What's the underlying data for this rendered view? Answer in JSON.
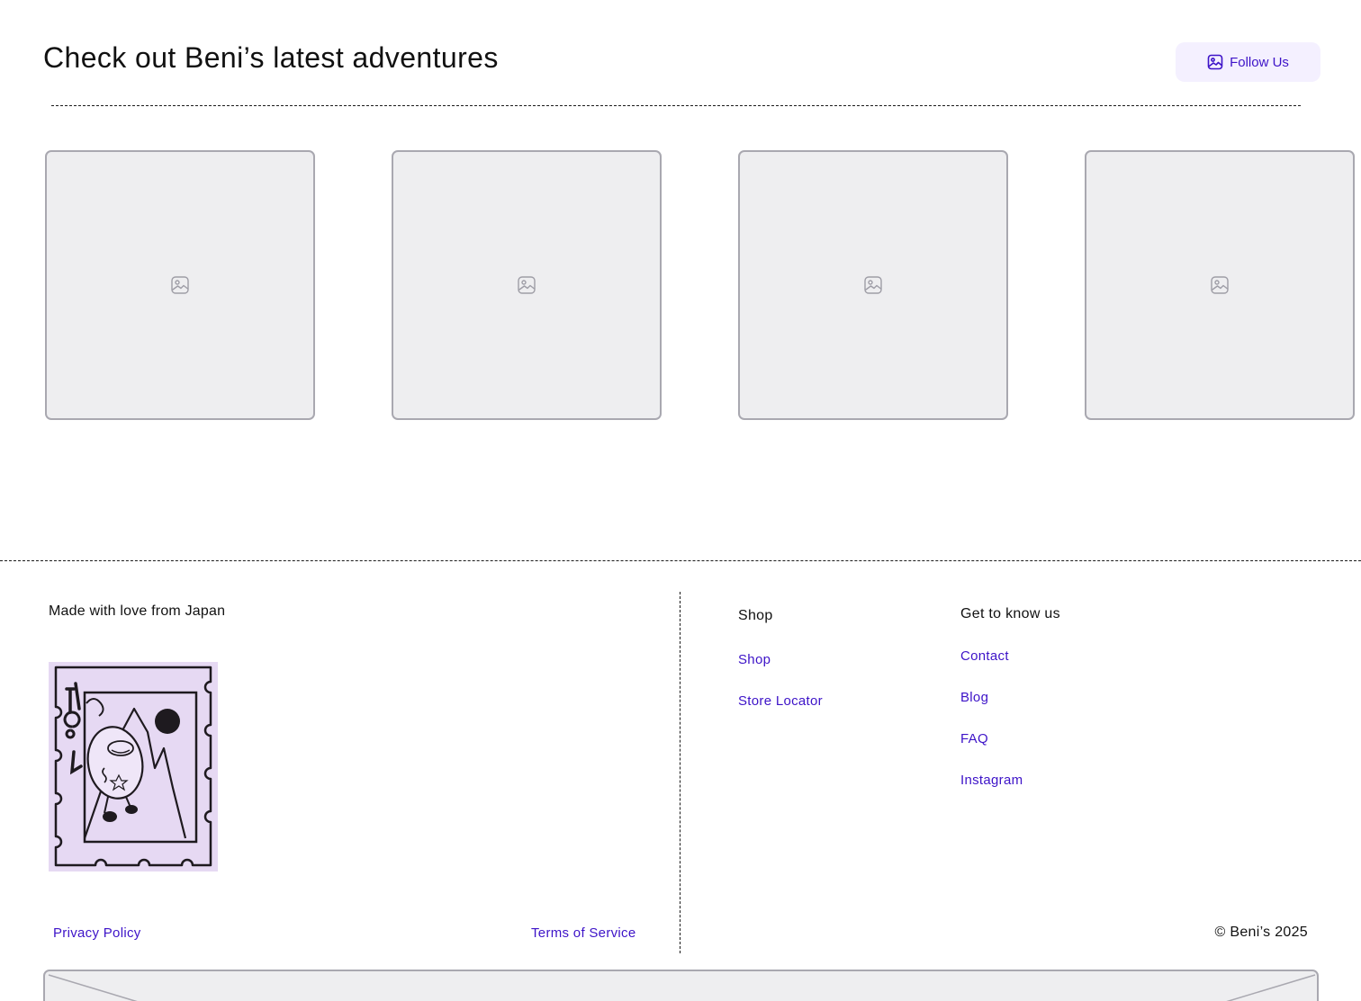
{
  "header": {
    "title": "Check out Beni’s latest adventures",
    "follow_label": "Follow Us",
    "follow_icon": "image-icon"
  },
  "gallery": {
    "items": [
      {
        "icon": "image-icon"
      },
      {
        "icon": "image-icon"
      },
      {
        "icon": "image-icon"
      },
      {
        "icon": "image-icon"
      }
    ]
  },
  "footer": {
    "tagline": "Made with love from Japan",
    "legal": {
      "privacy": "Privacy Policy",
      "terms": "Terms of Service"
    },
    "columns": [
      {
        "heading": "Shop",
        "links": [
          "Shop",
          "Store Locator"
        ]
      },
      {
        "heading": "Get to know us",
        "links": [
          "Contact",
          "Blog",
          "FAQ",
          "Instagram"
        ]
      }
    ],
    "copyright": "© Beni’s 2025"
  },
  "colors": {
    "accent": "#3d13c8",
    "button_bg": "#f4f0ff",
    "placeholder_bg": "#eeeef0",
    "placeholder_border": "#a9a8b0",
    "stamp_bg": "#e6d9f3"
  }
}
